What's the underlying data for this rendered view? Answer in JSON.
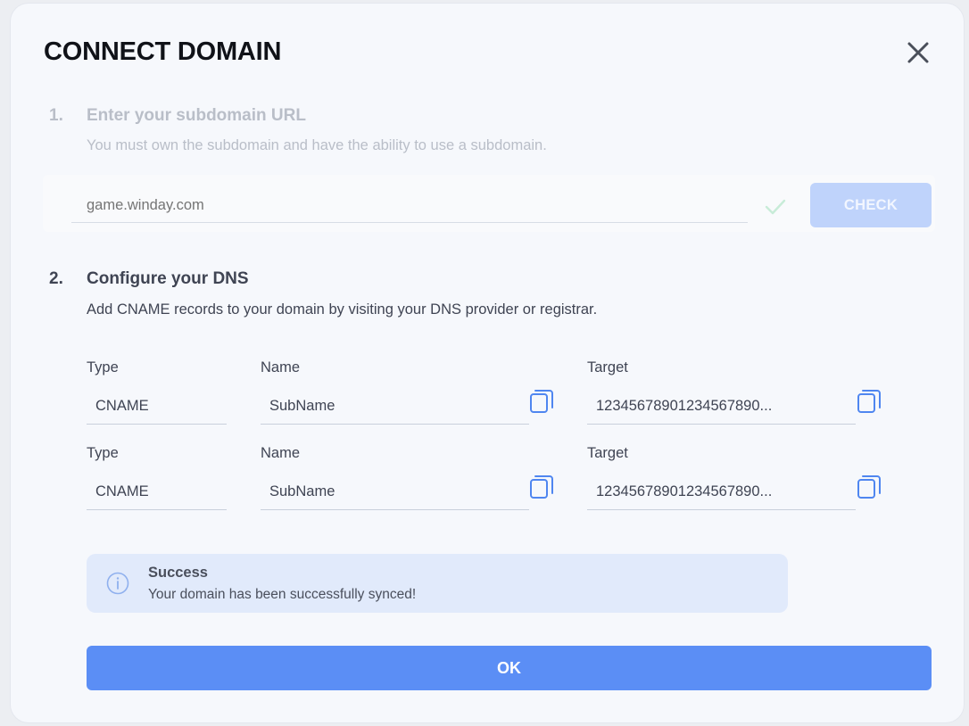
{
  "dialog": {
    "title": "CONNECT DOMAIN",
    "close_icon": "close-icon"
  },
  "step1": {
    "number": "1.",
    "title": "Enter your subdomain URL",
    "description": "You must own the subdomain and have the ability to use a subdomain.",
    "url_placeholder": "game.winday.com",
    "url_value": "",
    "check_icon": "checkmark-icon",
    "check_label": "CHECK",
    "muted_color": "#b9bec8"
  },
  "step2": {
    "number": "2.",
    "title": "Configure your DNS",
    "description": "Add CNAME records to your domain by visiting your DNS provider or registrar.",
    "records": [
      {
        "type_label": "Type",
        "type_value": "CNAME",
        "name_label": "Name",
        "name_value": "SubName",
        "target_label": "Target",
        "target_value": "12345678901234567890..."
      },
      {
        "type_label": "Type",
        "type_value": "CNAME",
        "name_label": "Name",
        "name_value": "SubName",
        "target_label": "Target",
        "target_value": "12345678901234567890..."
      }
    ],
    "copy_icon": "copy-icon"
  },
  "alert": {
    "icon": "info-icon",
    "title": "Success",
    "message": "Your domain has been successfully synced!",
    "background": "#e1eafb"
  },
  "footer": {
    "ok_label": "OK",
    "accent_color": "#5b8ef5"
  }
}
